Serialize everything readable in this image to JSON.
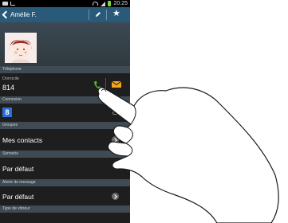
{
  "status_bar": {
    "time": "20:25"
  },
  "header": {
    "contact_name": "Amélie F."
  },
  "sections": {
    "phone": "Téléphone",
    "connection": "Connexion",
    "groups": "Groupes",
    "ringtone": "Sonnerie",
    "message_alert": "Alerte de message",
    "vibration": "Type de vibreur"
  },
  "phone_entry": {
    "type": "Domicile",
    "number": "814"
  },
  "groups_value": "Mes contacts",
  "ringtone_value": "Par défaut",
  "message_alert_value": "Par défaut",
  "icons": {
    "call": "phone-icon",
    "message": "envelope-icon",
    "google": "google-icon",
    "edit": "pencil-icon",
    "favorite": "star-icon"
  },
  "colors": {
    "header": "#2a5a79",
    "call_green": "#5cb82e",
    "message_orange": "#f5a61a",
    "google_blue": "#2d6fd8"
  }
}
